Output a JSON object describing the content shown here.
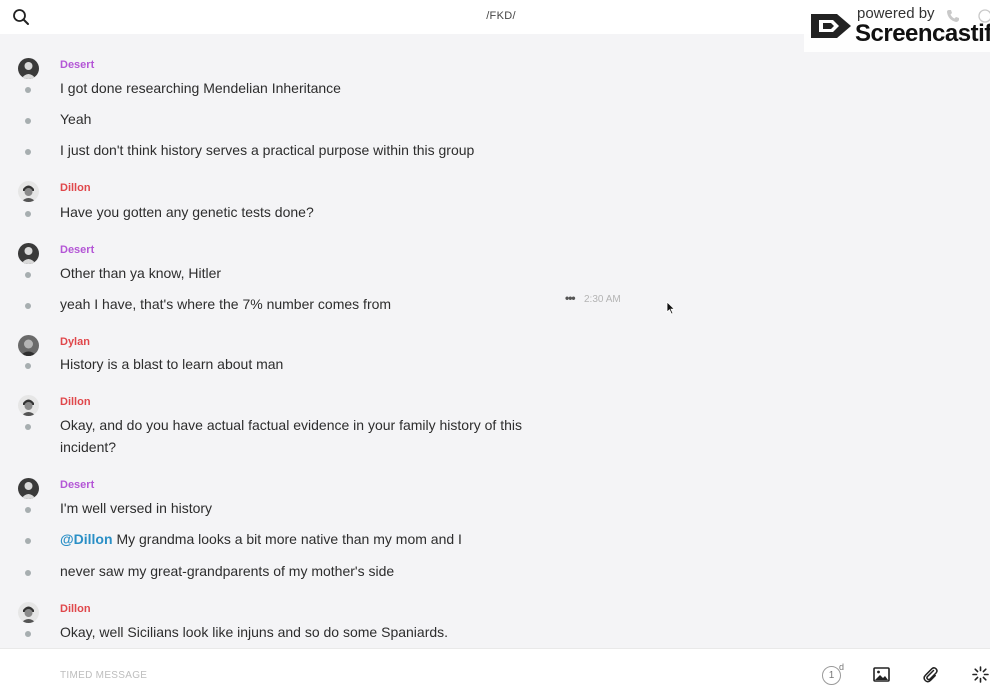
{
  "header": {
    "conversation_title": "/FKD/"
  },
  "watermark": {
    "powered_by": "powered by",
    "brand": "Screencastify"
  },
  "colors": {
    "desert": "#b456d6",
    "dillon": "#e0474b",
    "dylan": "#e0474b",
    "mention": "#2a8fc6"
  },
  "messages": {
    "groups": [
      {
        "sender": "Desert",
        "lines": [
          "I got done researching Mendelian Inheritance",
          "Yeah",
          "I just don't think history serves a practical purpose within this group"
        ]
      },
      {
        "sender": "Dillon",
        "lines": [
          "Have you gotten any genetic tests done?"
        ]
      },
      {
        "sender": "Desert",
        "lines": [
          "Other than ya know, Hitler",
          "yeah I have, that's where the 7% number comes from"
        ],
        "timestamp": "2:30 AM"
      },
      {
        "sender": "Dylan",
        "lines": [
          "History is a blast to learn about man"
        ]
      },
      {
        "sender": "Dillon",
        "lines": [
          "Okay, and do you have actual factual evidence in your family history of this incident?"
        ]
      },
      {
        "sender": "Desert",
        "lines": [
          "I'm well versed in history",
          "My grandma looks a bit more native than my mom and I",
          "never saw my great-grandparents of my mother's side"
        ],
        "mention": "@Dillon"
      },
      {
        "sender": "Dillon",
        "lines": [
          "Okay, well Sicilians look like injuns and so do some Spaniards."
        ]
      }
    ]
  },
  "composer": {
    "placeholder": "TIMED MESSAGE",
    "timer_value": "1",
    "timer_unit": "d"
  },
  "icons": {
    "search": "search-icon",
    "more": "more-options-icon",
    "image": "image-icon",
    "attach": "paperclip-icon",
    "settings": "loading-spinner-icon"
  }
}
